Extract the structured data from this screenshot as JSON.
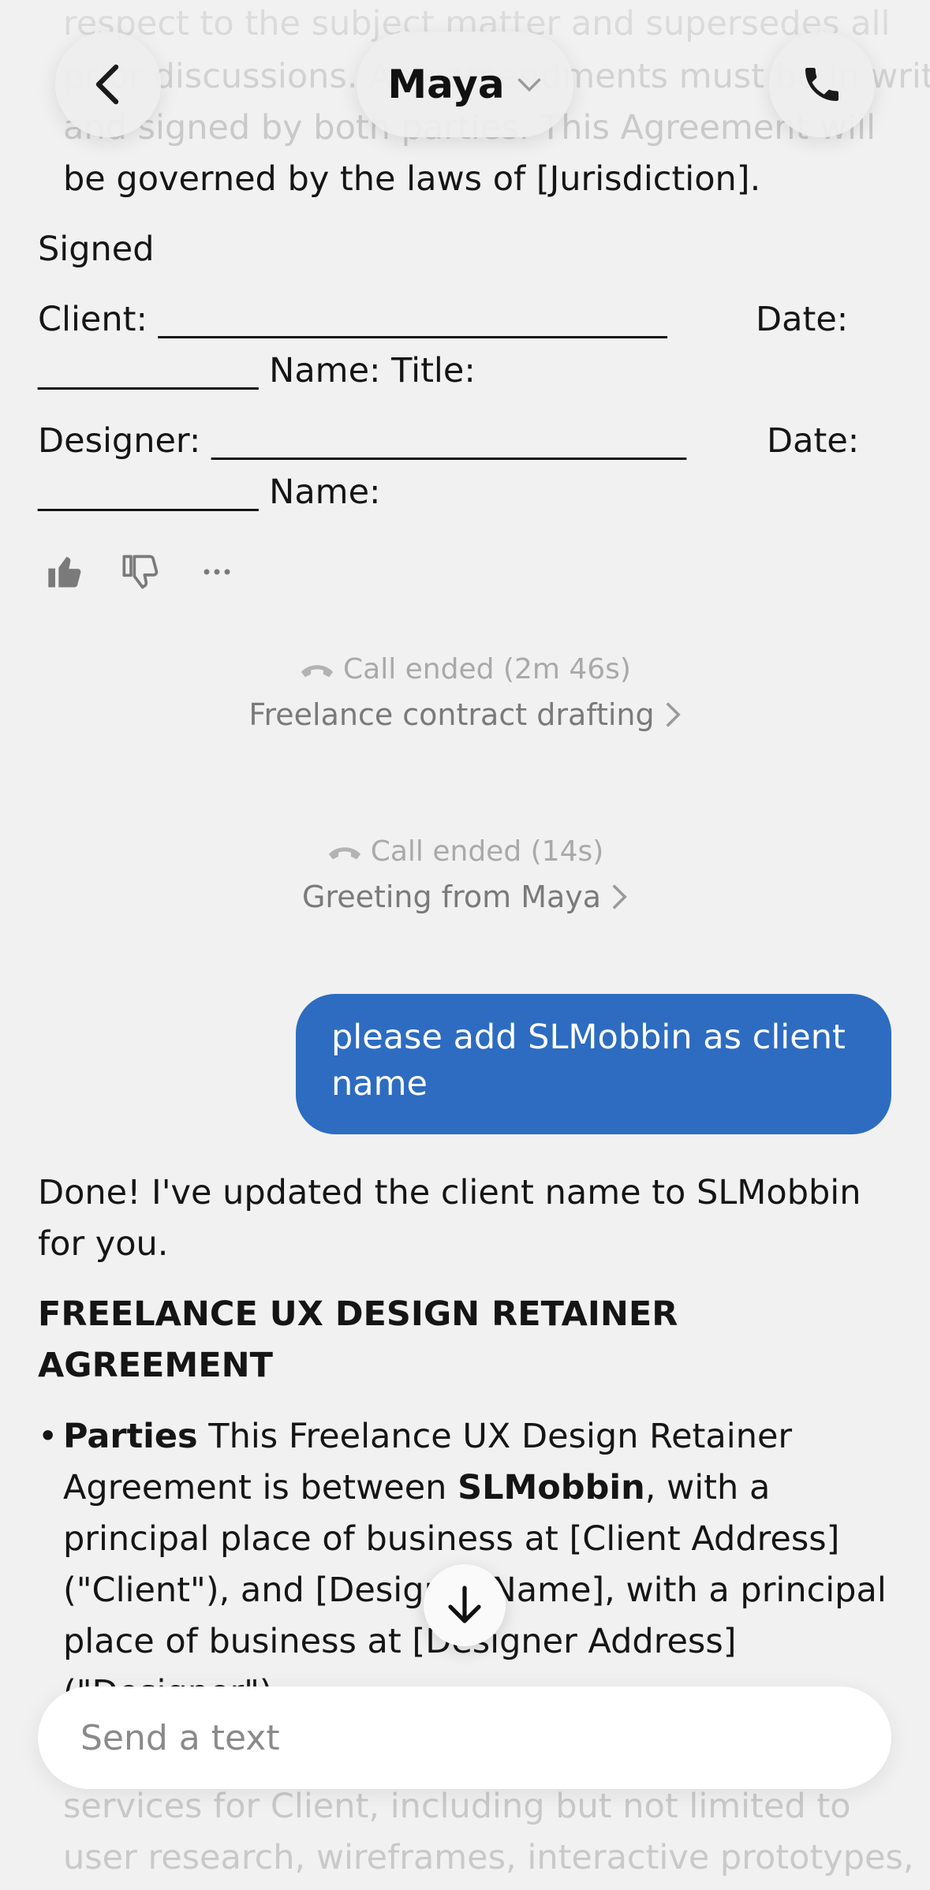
{
  "header": {
    "title": "Maya"
  },
  "transcript_top": {
    "faded_line1": "respect to the subject matter and supersedes all",
    "faded_line2": "prior discussions. Any amendments must be in writing",
    "faded_line3": "and signed by both parties. This Agreement will",
    "line4": "be governed by the laws of [Jurisdiction].",
    "signed": "Signed",
    "client_line": "Client: ______________________________",
    "client_date": "Date:",
    "client_line2": "_____________ Name: Title:",
    "designer_line": "Designer: ____________________________",
    "designer_date": "Date:",
    "designer_line2": "_____________ Name:"
  },
  "calls": [
    {
      "status": "Call ended (2m 46s)",
      "title": "Freelance contract drafting"
    },
    {
      "status": "Call ended (14s)",
      "title": "Greeting from Maya"
    }
  ],
  "user_message": {
    "line1": "please add SLMobbin as client",
    "line2": "name"
  },
  "reply": {
    "line1": "Done! I've updated the client name to SLMobbin",
    "line2": "for you.",
    "heading1": "FREELANCE UX DESIGN RETAINER",
    "heading2": "AGREEMENT",
    "bullet": "•",
    "p1_bold": "Parties",
    "p1_rest": " This Freelance UX Design Retainer",
    "p2_a": "Agreement is between ",
    "p2_bold": "SLMobbin",
    "p2_b": ", with a",
    "p3": "principal place of business at [Client Address]",
    "p4": "(\"Client\"), and [Designer Name], with a principal",
    "p5": "place of business at [Designer Address]",
    "p6": "(\"Designer\").",
    "p7": "services for Client, including but not limited to",
    "p8": "user research, wireframes, interactive prototypes,"
  },
  "composer": {
    "placeholder": "Send a text"
  }
}
